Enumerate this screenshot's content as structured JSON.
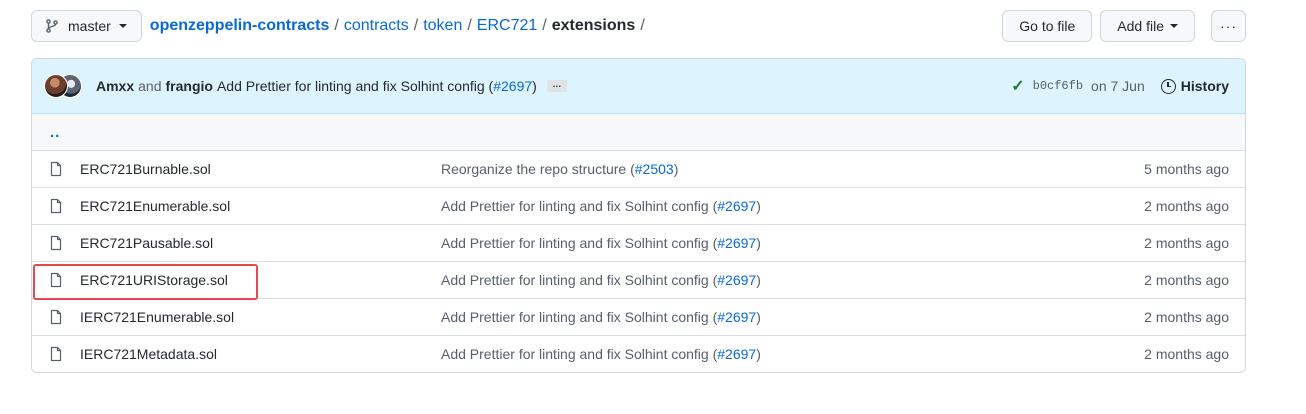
{
  "branch": {
    "label": "master"
  },
  "breadcrumb": {
    "repo": "openzeppelin-contracts",
    "parts": [
      "contracts",
      "token",
      "ERC721"
    ],
    "current": "extensions",
    "separator": "/"
  },
  "actions": {
    "go_to_file": "Go to file",
    "add_file": "Add file",
    "more": "···"
  },
  "commit": {
    "author1": "Amxx",
    "and": "and",
    "author2": "frangio",
    "message": "Add Prettier for linting and fix Solhint config (",
    "pr": "#2697",
    "close": ")",
    "ellipsis": "…",
    "sha": "b0cf6fb",
    "date": "on 7 Jun",
    "history": "History"
  },
  "up_dir": "..",
  "files": [
    {
      "name": "ERC721Burnable.sol",
      "msg": "Reorganize the repo structure (",
      "pr": "#2503",
      "close": ")",
      "age": "5 months ago"
    },
    {
      "name": "ERC721Enumerable.sol",
      "msg": "Add Prettier for linting and fix Solhint config (",
      "pr": "#2697",
      "close": ")",
      "age": "2 months ago"
    },
    {
      "name": "ERC721Pausable.sol",
      "msg": "Add Prettier for linting and fix Solhint config (",
      "pr": "#2697",
      "close": ")",
      "age": "2 months ago"
    },
    {
      "name": "ERC721URIStorage.sol",
      "msg": "Add Prettier for linting and fix Solhint config (",
      "pr": "#2697",
      "close": ")",
      "age": "2 months ago"
    },
    {
      "name": "IERC721Enumerable.sol",
      "msg": "Add Prettier for linting and fix Solhint config (",
      "pr": "#2697",
      "close": ")",
      "age": "2 months ago"
    },
    {
      "name": "IERC721Metadata.sol",
      "msg": "Add Prettier for linting and fix Solhint config (",
      "pr": "#2697",
      "close": ")",
      "age": "2 months ago"
    }
  ],
  "colors": {
    "link": "#0969da",
    "highlight": "#e5484d",
    "commit_bg": "#ddf4ff"
  }
}
